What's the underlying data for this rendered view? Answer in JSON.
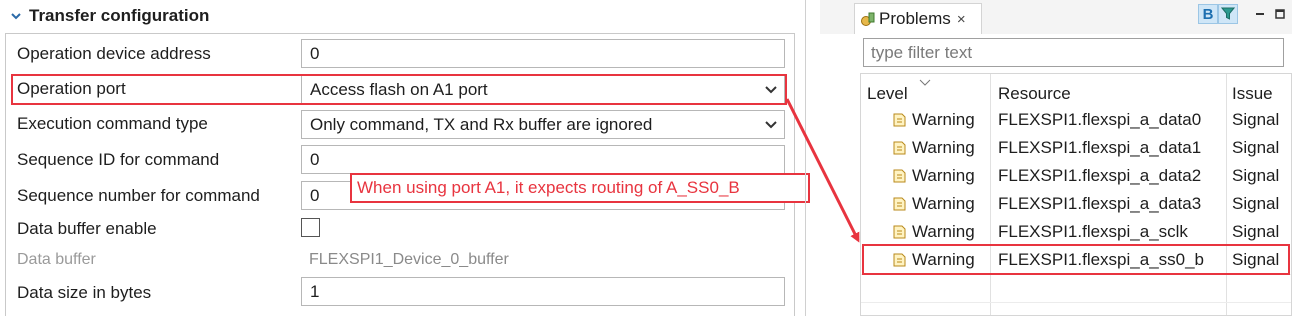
{
  "config": {
    "section_title": "Transfer configuration",
    "rows": [
      {
        "label": "Operation device address",
        "value": "0"
      },
      {
        "label": "Operation port",
        "value": "Access flash on A1 port"
      },
      {
        "label": "Execution command type",
        "value": "Only command, TX and Rx buffer are ignored"
      },
      {
        "label": "Sequence ID for command",
        "value": "0"
      },
      {
        "label": "Sequence number for command",
        "value": "0"
      },
      {
        "label": "Data buffer enable",
        "checked": false
      },
      {
        "label": "Data buffer",
        "value": "FLEXSPI1_Device_0_buffer"
      },
      {
        "label": "Data size in bytes",
        "value": "1"
      }
    ]
  },
  "annotation": {
    "text": "When using port A1, it expects routing of A_SS0_B",
    "color": "#e8343f"
  },
  "problems": {
    "tab_label": "Problems",
    "tab_close": "×",
    "toolbar": {
      "b_label": "B",
      "filter_icon": "filter-icon",
      "minimize": "minimize-icon",
      "maximize": "maximize-icon"
    },
    "filter_placeholder": "type filter text",
    "columns": {
      "level": "Level",
      "resource": "Resource",
      "issue": "Issue"
    },
    "rows": [
      {
        "level": "Warning",
        "resource": "FLEXSPI1.flexspi_a_data0",
        "issue": "Signal"
      },
      {
        "level": "Warning",
        "resource": "FLEXSPI1.flexspi_a_data1",
        "issue": "Signal"
      },
      {
        "level": "Warning",
        "resource": "FLEXSPI1.flexspi_a_data2",
        "issue": "Signal"
      },
      {
        "level": "Warning",
        "resource": "FLEXSPI1.flexspi_a_data3",
        "issue": "Signal"
      },
      {
        "level": "Warning",
        "resource": "FLEXSPI1.flexspi_a_sclk",
        "issue": "Signal"
      },
      {
        "level": "Warning",
        "resource": "FLEXSPI1.flexspi_a_ss0_b",
        "issue": "Signal"
      }
    ]
  }
}
